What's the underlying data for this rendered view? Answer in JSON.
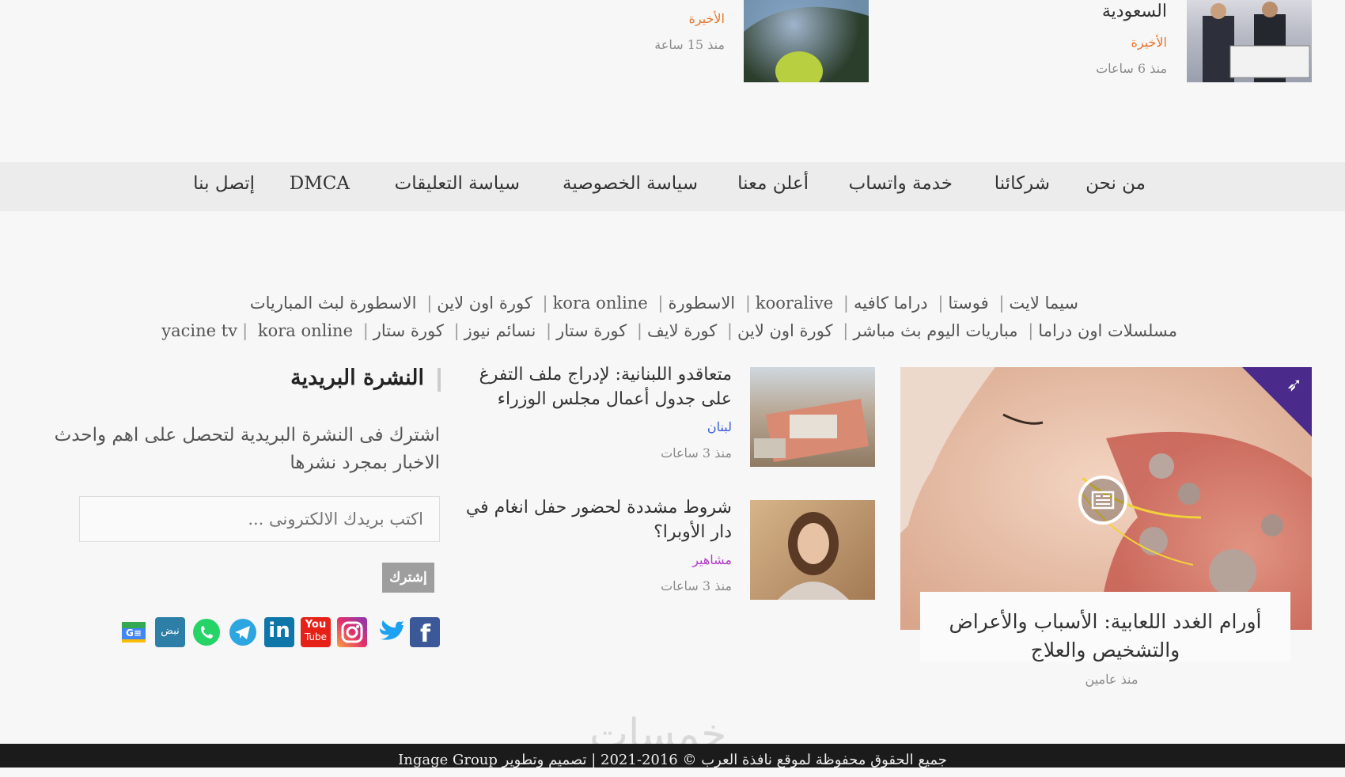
{
  "top_articles": [
    {
      "title": "السعودية",
      "category": "الأخيرة",
      "time": "منذ 6 ساعات"
    },
    {
      "category": "الأخيرة",
      "time": "منذ 15 ساعة"
    }
  ],
  "nav": {
    "items": [
      "من نحن",
      "شركائنا",
      "خدمة واتساب",
      "أعلن معنا",
      "سياسة الخصوصية",
      "سياسة التعليقات",
      "DMCA",
      "إتصل بنا"
    ]
  },
  "tags": {
    "row1": [
      "سيما لايت",
      "فوستا",
      "دراما كافيه",
      "kooralive",
      "الاسطورة",
      "kora online",
      "كورة اون لاين",
      "الاسطورة لبث المباريات"
    ],
    "row2": [
      "مسلسلات اون دراما",
      "مباريات اليوم بث مباشر",
      "كورة اون لاين",
      "كورة لايف",
      "كورة ستار",
      "نسائم نيوز",
      "كورة ستار",
      "yacine tv",
      "kora online"
    ]
  },
  "featured": {
    "title": "أورام الغدد اللعابية: الأسباب والأعراض والتشخيص والعلاج",
    "time": "منذ عامين"
  },
  "side_articles": [
    {
      "title": "متعاقدو اللبنانية: لإدراج ملف التفرغ على جدول أعمال مجلس الوزراء",
      "category": "لبنان",
      "time": "منذ 3 ساعات"
    },
    {
      "title": "شروط مشددة لحضور حفل انغام في دار الأوبرا؟",
      "category": "مشاهير",
      "time": "منذ 3 ساعات"
    }
  ],
  "newsletter": {
    "title": "النشرة البريدية",
    "desc": "اشترك فى النشرة البريدية لتحصل على اهم واحدث الاخبار بمجرد نشرها",
    "placeholder": "اكتب بريدك الالكترونى ...",
    "button": "إشترك"
  },
  "social": [
    "facebook-icon",
    "twitter-icon",
    "instagram-icon",
    "youtube-icon",
    "linkedin-icon",
    "telegram-icon",
    "whatsapp-icon",
    "nabd-icon",
    "google-news-icon"
  ],
  "social_labels": {
    "youtube_top": "You",
    "youtube_bottom": "Tube",
    "linkedin": "in",
    "nabd": "نبض",
    "google_news": "G≡"
  },
  "footer": {
    "text": "جميع الحقوق محفوظة لموقع نافذة العرب © 2016-2021 | تصميم وتطوير Ingage Group"
  },
  "watermark": "خمسات"
}
